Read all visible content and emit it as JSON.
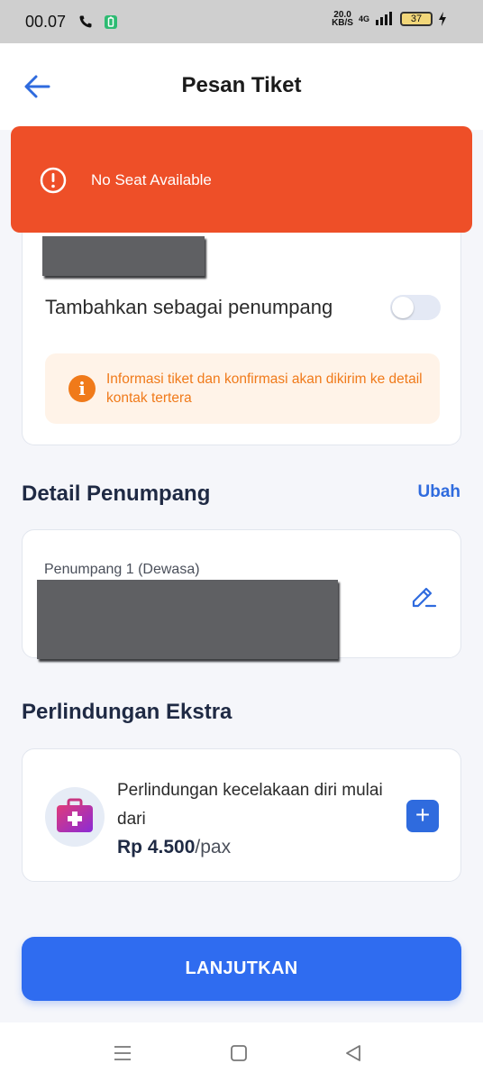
{
  "status_bar": {
    "time": "00.07",
    "net_speed_value": "20.0",
    "net_speed_unit": "KB/S",
    "network_type": "4G",
    "battery_level": "37"
  },
  "header": {
    "title": "Pesan Tiket"
  },
  "toast": {
    "message": "No Seat Available"
  },
  "contact": {
    "add_as_passenger_label": "Tambahkan sebagai penumpang",
    "toggle_on": false,
    "info_text": "Informasi tiket dan konfirmasi akan dikirim ke detail kontak tertera"
  },
  "passenger_section": {
    "title": "Detail Penumpang",
    "edit_link": "Ubah",
    "passengers": [
      {
        "label": "Penumpang 1 (Dewasa)"
      }
    ]
  },
  "extra_section": {
    "title": "Perlindungan Ekstra",
    "item_title": "Perlindungan kecelakaan diri mulai dari",
    "price": "Rp 4.500",
    "price_unit": "/pax"
  },
  "actions": {
    "continue_label": "LANJUTKAN"
  },
  "colors": {
    "accent": "#2f6cf0",
    "toast": "#ee4f28",
    "info": "#f07a1a"
  }
}
